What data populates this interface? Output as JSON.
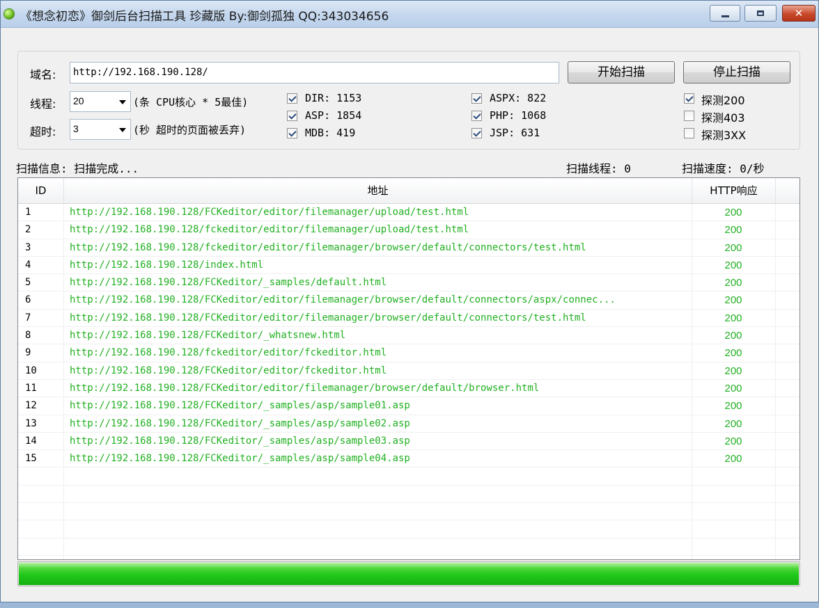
{
  "window": {
    "title": "《想念初恋》御剑后台扫描工具 珍藏版 By:御剑孤独 QQ:343034656",
    "controls": {
      "minimize": "minimize-icon",
      "maximize": "maximize-icon",
      "close": "close-icon",
      "close_glyph": "✕"
    }
  },
  "form": {
    "domain_label": "域名:",
    "domain_value": "http://192.168.190.128/",
    "threads_label": "线程:",
    "threads_value": "20",
    "threads_hint": "(条 CPU核心 * 5最佳)",
    "timeout_label": "超时:",
    "timeout_value": "3",
    "timeout_hint": "(秒 超时的页面被丢弃)",
    "start_button": "开始扫描",
    "stop_button": "停止扫描"
  },
  "dictionaries": [
    {
      "label": "DIR: 1153",
      "checked": true
    },
    {
      "label": "ASP: 1854",
      "checked": true
    },
    {
      "label": "MDB: 419",
      "checked": true
    },
    {
      "label": "ASPX: 822",
      "checked": true
    },
    {
      "label": "PHP: 1068",
      "checked": true
    },
    {
      "label": "JSP: 631",
      "checked": true
    }
  ],
  "probes": [
    {
      "label": "探测200",
      "checked": true
    },
    {
      "label": "探测403",
      "checked": false
    },
    {
      "label": "探测3XX",
      "checked": false
    }
  ],
  "status": {
    "info": "扫描信息: 扫描完成...",
    "threads": "扫描线程: 0",
    "speed": "扫描速度: 0/秒"
  },
  "table": {
    "columns": [
      "ID",
      "地址",
      "HTTP响应"
    ],
    "rows": [
      {
        "id": "1",
        "url": "http://192.168.190.128/FCKeditor/editor/filemanager/upload/test.html",
        "code": "200"
      },
      {
        "id": "2",
        "url": "http://192.168.190.128/fckeditor/editor/filemanager/upload/test.html",
        "code": "200"
      },
      {
        "id": "3",
        "url": "http://192.168.190.128/fckeditor/editor/filemanager/browser/default/connectors/test.html",
        "code": "200"
      },
      {
        "id": "4",
        "url": "http://192.168.190.128/index.html",
        "code": "200"
      },
      {
        "id": "5",
        "url": "http://192.168.190.128/FCKeditor/_samples/default.html",
        "code": "200"
      },
      {
        "id": "6",
        "url": "http://192.168.190.128/FCKeditor/editor/filemanager/browser/default/connectors/aspx/connec...",
        "code": "200"
      },
      {
        "id": "7",
        "url": "http://192.168.190.128/FCKeditor/editor/filemanager/browser/default/connectors/test.html",
        "code": "200"
      },
      {
        "id": "8",
        "url": "http://192.168.190.128/FCKeditor/_whatsnew.html",
        "code": "200"
      },
      {
        "id": "9",
        "url": "http://192.168.190.128/fckeditor/editor/fckeditor.html",
        "code": "200"
      },
      {
        "id": "10",
        "url": "http://192.168.190.128/FCKeditor/editor/fckeditor.html",
        "code": "200"
      },
      {
        "id": "11",
        "url": "http://192.168.190.128/FCKeditor/editor/filemanager/browser/default/browser.html",
        "code": "200"
      },
      {
        "id": "12",
        "url": "http://192.168.190.128/FCKeditor/_samples/asp/sample01.asp",
        "code": "200"
      },
      {
        "id": "13",
        "url": "http://192.168.190.128/FCKeditor/_samples/asp/sample02.asp",
        "code": "200"
      },
      {
        "id": "14",
        "url": "http://192.168.190.128/FCKeditor/_samples/asp/sample03.asp",
        "code": "200"
      },
      {
        "id": "15",
        "url": "http://192.168.190.128/FCKeditor/_samples/asp/sample04.asp",
        "code": "200"
      }
    ],
    "empty_rows": 5
  },
  "progress": {
    "fraction": 1.0,
    "color": "#1fc81a"
  },
  "colors": {
    "url_text": "#22b022",
    "code_text": "#22b022"
  }
}
